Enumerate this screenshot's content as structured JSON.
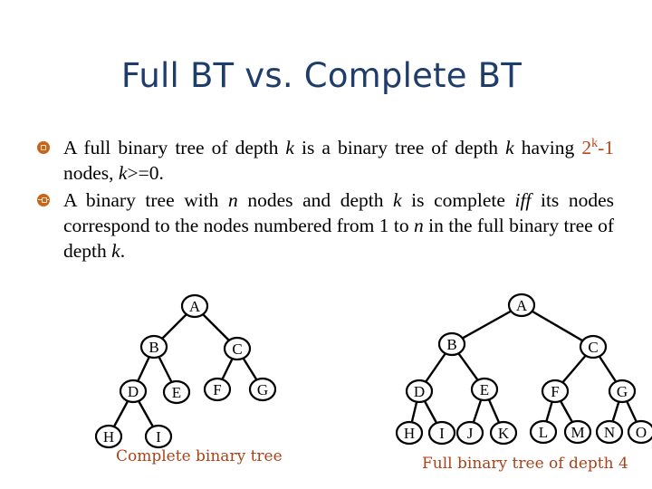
{
  "slide": {
    "title": "Full BT vs. Complete BT",
    "accent_color": "#c8651b",
    "title_color": "#1f3d6b",
    "bullets": [
      {
        "icon": "bullet-square-icon",
        "parts": {
          "a": "A full binary tree of depth ",
          "k1": "k",
          "b": " is a binary tree of depth ",
          "k2": "k",
          "c": " having ",
          "formula_base": "2",
          "formula_exp": "k",
          "formula_tail": "-1",
          "d": " nodes, ",
          "k3": "k",
          "e": ">=0."
        }
      },
      {
        "icon": "bullet-line-icon",
        "parts": {
          "a": "A binary tree with ",
          "n1": "n",
          "b": " nodes and depth ",
          "k1": "k",
          "c": " is complete ",
          "iff": "iff",
          "d": " its nodes correspond to the nodes numbered from 1 to ",
          "n2": "n",
          "e": " in the full binary tree of depth ",
          "k2": "k",
          "f": "."
        }
      }
    ]
  },
  "complete_tree": {
    "caption": "Complete binary tree",
    "nodes": [
      "A",
      "B",
      "C",
      "D",
      "E",
      "F",
      "G",
      "H",
      "I"
    ],
    "edges": [
      [
        "A",
        "B"
      ],
      [
        "A",
        "C"
      ],
      [
        "B",
        "D"
      ],
      [
        "B",
        "E"
      ],
      [
        "C",
        "F"
      ],
      [
        "C",
        "G"
      ],
      [
        "D",
        "H"
      ],
      [
        "D",
        "I"
      ]
    ]
  },
  "full_tree": {
    "caption": "Full binary tree of depth 4",
    "nodes": [
      "A",
      "B",
      "C",
      "D",
      "E",
      "F",
      "G",
      "H",
      "I",
      "J",
      "K",
      "L",
      "M",
      "N",
      "O"
    ],
    "edges": [
      [
        "A",
        "B"
      ],
      [
        "A",
        "C"
      ],
      [
        "B",
        "D"
      ],
      [
        "B",
        "E"
      ],
      [
        "C",
        "F"
      ],
      [
        "C",
        "G"
      ],
      [
        "D",
        "H"
      ],
      [
        "D",
        "I"
      ],
      [
        "E",
        "J"
      ],
      [
        "E",
        "K"
      ],
      [
        "F",
        "L"
      ],
      [
        "F",
        "M"
      ],
      [
        "G",
        "N"
      ],
      [
        "G",
        "O"
      ]
    ]
  }
}
